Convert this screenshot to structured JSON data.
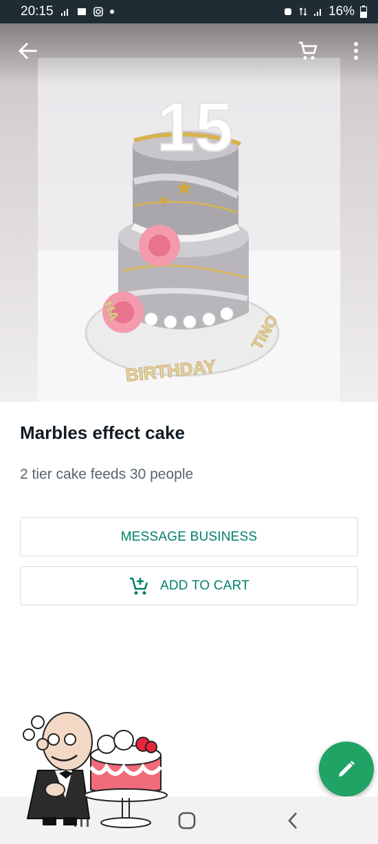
{
  "status_bar": {
    "time": "20:15",
    "battery": "16%"
  },
  "app_bar": {
    "back_icon": "arrow-back-icon",
    "cart_icon": "shopping-cart-icon",
    "more_icon": "more-vert-icon"
  },
  "hero": {
    "cake_topper": "15",
    "board_text": "HAPPY BIRTHDAY TINO"
  },
  "product": {
    "title": "Marbles effect cake",
    "description": "2 tier cake feeds 30 people"
  },
  "buttons": {
    "message_label": "MESSAGE BUSINESS",
    "add_to_cart_label": "ADD TO CART"
  },
  "fab": {
    "icon": "pencil-icon"
  },
  "nav": {
    "recents_icon": "recents-icon",
    "home_icon": "home-icon",
    "back_icon": "nav-back-icon"
  },
  "colors": {
    "accent": "#008069",
    "fab": "#21a366",
    "status_bar": "#1f2c34"
  }
}
